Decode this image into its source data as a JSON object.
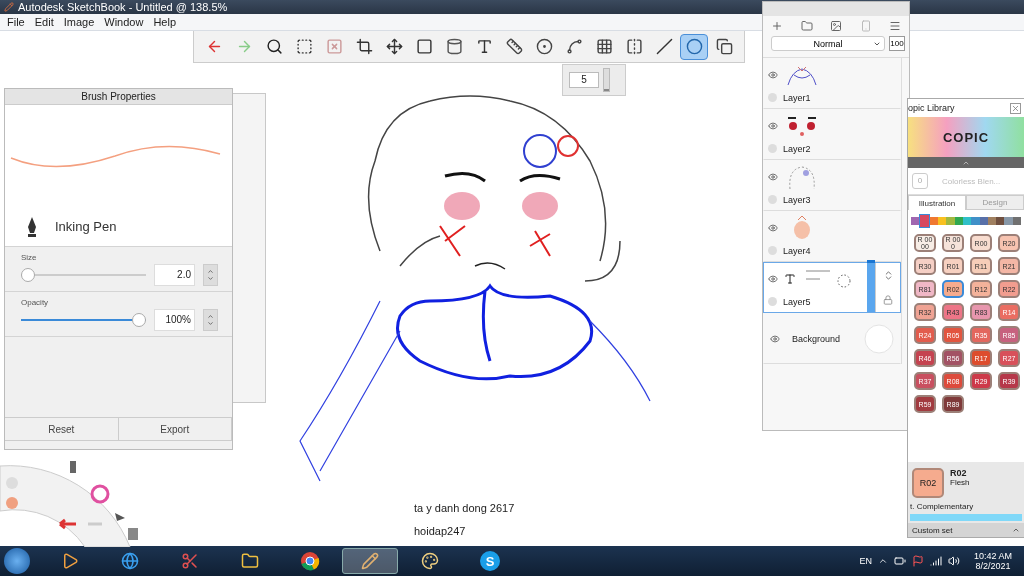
{
  "window": {
    "title": "Autodesk SketchBook - Untitled @ 138.5%"
  },
  "menu": [
    "File",
    "Edit",
    "Image",
    "Window",
    "Help"
  ],
  "toolbar": {
    "tools": [
      {
        "kind": "undo",
        "selected": false
      },
      {
        "kind": "redo",
        "selected": false
      },
      {
        "kind": "zoom",
        "selected": false
      },
      {
        "kind": "select",
        "selected": false
      },
      {
        "kind": "clear",
        "selected": false
      },
      {
        "kind": "crop",
        "selected": false
      },
      {
        "kind": "move",
        "selected": false
      },
      {
        "kind": "distort",
        "selected": false
      },
      {
        "kind": "fill",
        "selected": false
      },
      {
        "kind": "text",
        "selected": false
      },
      {
        "kind": "ruler",
        "selected": false
      },
      {
        "kind": "ellipse",
        "selected": false
      },
      {
        "kind": "curve",
        "selected": false
      },
      {
        "kind": "perspective",
        "selected": false
      },
      {
        "kind": "symmetry",
        "selected": false
      },
      {
        "kind": "stroke",
        "selected": false
      },
      {
        "kind": "oval",
        "selected": true
      },
      {
        "kind": "copy",
        "selected": false
      }
    ]
  },
  "brush_size": {
    "value": "5",
    "level": 0.1
  },
  "brush_properties": {
    "title": "Brush Properties",
    "brush_name": "Inking Pen",
    "sliders": [
      {
        "label": "Size",
        "value": "2.0",
        "level": 0
      },
      {
        "label": "Opacity",
        "value": "100%",
        "level": 1
      }
    ],
    "buttons": [
      "Reset",
      "Export"
    ]
  },
  "layers_panel": {
    "blend_mode": "Normal",
    "opacity": "100",
    "layers": [
      {
        "name": "Layer1",
        "kind": "sketch",
        "visible": true,
        "selected": false
      },
      {
        "name": "Layer2",
        "kind": "eyes",
        "visible": true,
        "selected": false
      },
      {
        "name": "Layer3",
        "kind": "outline",
        "visible": true,
        "selected": false
      },
      {
        "name": "Layer4",
        "kind": "skin",
        "visible": true,
        "selected": false
      },
      {
        "name": "Layer5",
        "kind": "text",
        "visible": true,
        "selected": true
      },
      {
        "name": "Background",
        "kind": "background",
        "visible": true,
        "selected": false
      }
    ]
  },
  "copic_library": {
    "title": "opic Library",
    "logo": "COPIC",
    "blender": {
      "code": "0",
      "name": "Colorless Blen..."
    },
    "tabs": [
      {
        "label": "Illustration",
        "selected": true
      },
      {
        "label": "Design",
        "selected": false
      }
    ],
    "families": [
      {
        "color": "#a066b0",
        "selected": false
      },
      {
        "color": "#d84860",
        "selected": true
      },
      {
        "color": "#f07830",
        "selected": false
      },
      {
        "color": "#f8c020",
        "selected": false
      },
      {
        "color": "#a0b840",
        "selected": false
      },
      {
        "color": "#30a850",
        "selected": false
      },
      {
        "color": "#30c0c8",
        "selected": false
      },
      {
        "color": "#4090c8",
        "selected": false
      },
      {
        "color": "#5870a8",
        "selected": false
      },
      {
        "color": "#a08060",
        "selected": false
      },
      {
        "color": "#705040",
        "selected": false
      },
      {
        "color": "#8898a8",
        "selected": false
      },
      {
        "color": "#707070",
        "selected": false
      }
    ],
    "swatches": [
      {
        "code": "R 0000",
        "color": "#f7ede6",
        "selected": false
      },
      {
        "code": "R 000",
        "color": "#f6e3da",
        "selected": false
      },
      {
        "code": "R00",
        "color": "#f8dccf",
        "selected": false
      },
      {
        "code": "R20",
        "color": "#f7c3b0",
        "selected": false
      },
      {
        "code": "R30",
        "color": "#f5cfc5",
        "selected": false
      },
      {
        "code": "R01",
        "color": "#f7d0c0",
        "selected": false
      },
      {
        "code": "R11",
        "color": "#f6cdb8",
        "selected": false
      },
      {
        "code": "R21",
        "color": "#f4b6a5",
        "selected": false
      },
      {
        "code": "R81",
        "color": "#f0b7c6",
        "selected": false
      },
      {
        "code": "R02",
        "color": "#f5ab8e",
        "selected": true
      },
      {
        "code": "R12",
        "color": "#f4b29a",
        "selected": false
      },
      {
        "code": "R22",
        "color": "#f19d8f",
        "selected": false
      },
      {
        "code": "R32",
        "color": "#f0a394",
        "selected": false
      },
      {
        "code": "R43",
        "color": "#ed7587",
        "selected": false
      },
      {
        "code": "R83",
        "color": "#e796ad",
        "selected": false
      },
      {
        "code": "R14",
        "color": "#ea6d62",
        "selected": false
      },
      {
        "code": "R24",
        "color": "#e25c4d",
        "selected": false
      },
      {
        "code": "R05",
        "color": "#e2553f",
        "selected": false
      },
      {
        "code": "R35",
        "color": "#e3675e",
        "selected": false
      },
      {
        "code": "R85",
        "color": "#c7627f",
        "selected": false
      },
      {
        "code": "R46",
        "color": "#c54350",
        "selected": false
      },
      {
        "code": "R56",
        "color": "#a35264",
        "selected": false
      },
      {
        "code": "R17",
        "color": "#dd4c2d",
        "selected": false
      },
      {
        "code": "R27",
        "color": "#d8505a",
        "selected": false
      },
      {
        "code": "R37",
        "color": "#c95060",
        "selected": false
      },
      {
        "code": "R08",
        "color": "#dd4b3c",
        "selected": false
      },
      {
        "code": "R29",
        "color": "#cd3a4a",
        "selected": false
      },
      {
        "code": "R39",
        "color": "#b6384a",
        "selected": false
      },
      {
        "code": "R59",
        "color": "#a23b40",
        "selected": false
      },
      {
        "code": "R89",
        "color": "#7f3a3a",
        "selected": false
      }
    ],
    "current": {
      "code": "R02",
      "label": "R02",
      "name": "Flesh",
      "color": "#f5ab8e"
    },
    "complementary": "t. Complementary",
    "custom_set": "Custom set"
  },
  "canvas_texts": [
    "ta y danh dong 2617",
    "hoidap247"
  ],
  "taskbar": {
    "apps": [
      {
        "kind": "media",
        "selected": false
      },
      {
        "kind": "browser",
        "selected": false
      },
      {
        "kind": "snip",
        "selected": false
      },
      {
        "kind": "folder",
        "selected": false
      },
      {
        "kind": "chrome",
        "selected": false
      },
      {
        "kind": "pencil",
        "selected": true
      },
      {
        "kind": "paint",
        "selected": false
      },
      {
        "kind": "skype",
        "selected": false,
        "label": "S"
      }
    ],
    "language": "EN",
    "time": "10:42 AM",
    "date": "8/2/2021"
  }
}
